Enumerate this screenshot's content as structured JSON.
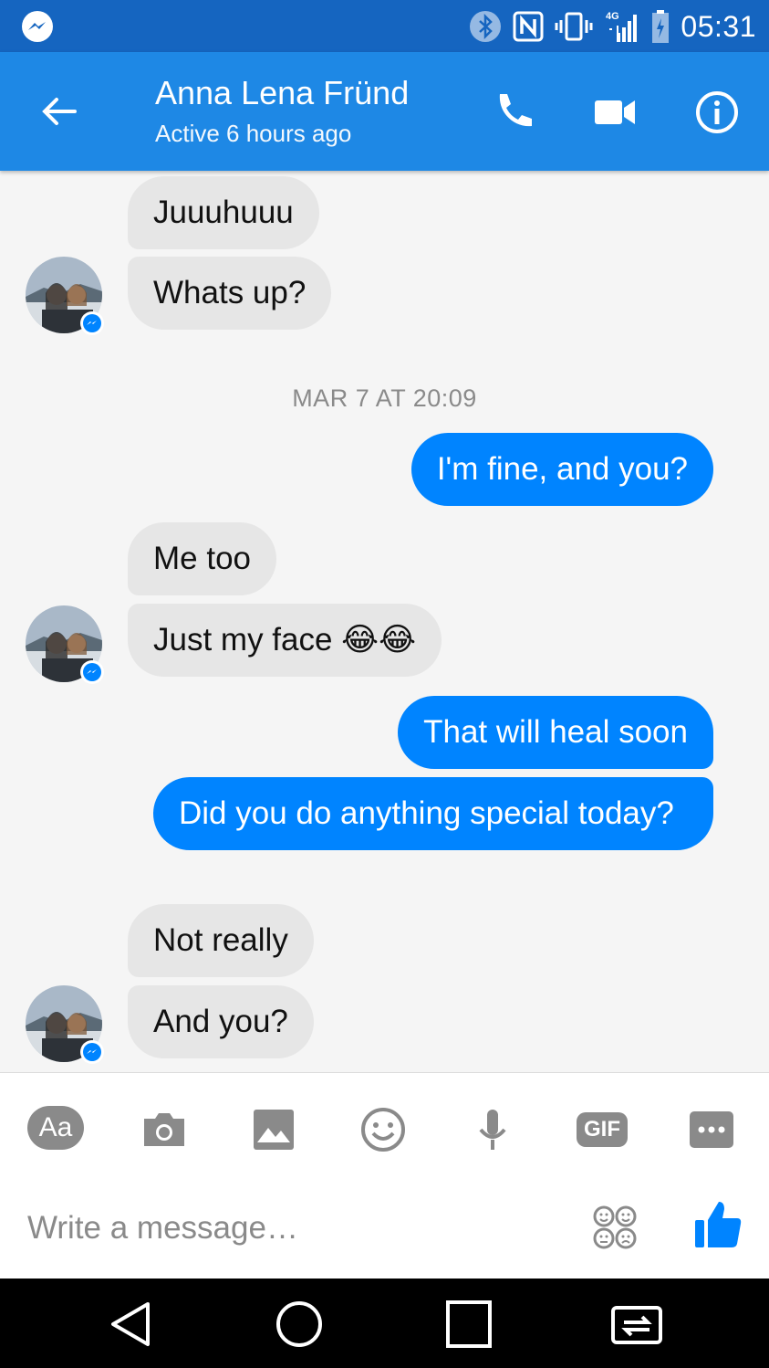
{
  "status_bar": {
    "time": "05:31",
    "network": "4G"
  },
  "header": {
    "contact_name": "Anna Lena Fründ",
    "contact_status": "Active 6 hours ago"
  },
  "messages": [
    {
      "from": "them",
      "text": "Juuuhuuu"
    },
    {
      "from": "them",
      "text": "Whats up?"
    },
    {
      "from": "me",
      "text": "I'm fine, and you?"
    },
    {
      "from": "them",
      "text": "Me too"
    },
    {
      "from": "them",
      "text": "Just my face 😂😂"
    },
    {
      "from": "me",
      "text": "That will heal soon"
    },
    {
      "from": "me",
      "text": "Did you do anything special today?"
    },
    {
      "from": "them",
      "text": "Not really"
    },
    {
      "from": "them",
      "text": "And you?"
    }
  ],
  "timestamp": "MAR 7 AT 20:09",
  "composer": {
    "aa_label": "Aa",
    "gif_label": "GIF",
    "placeholder": "Write a message…"
  },
  "colors": {
    "status_bar": "#1565c0",
    "header": "#1e88e5",
    "outgoing_bubble": "#0084ff",
    "incoming_bubble": "#e6e6e6",
    "accent": "#0084ff"
  }
}
